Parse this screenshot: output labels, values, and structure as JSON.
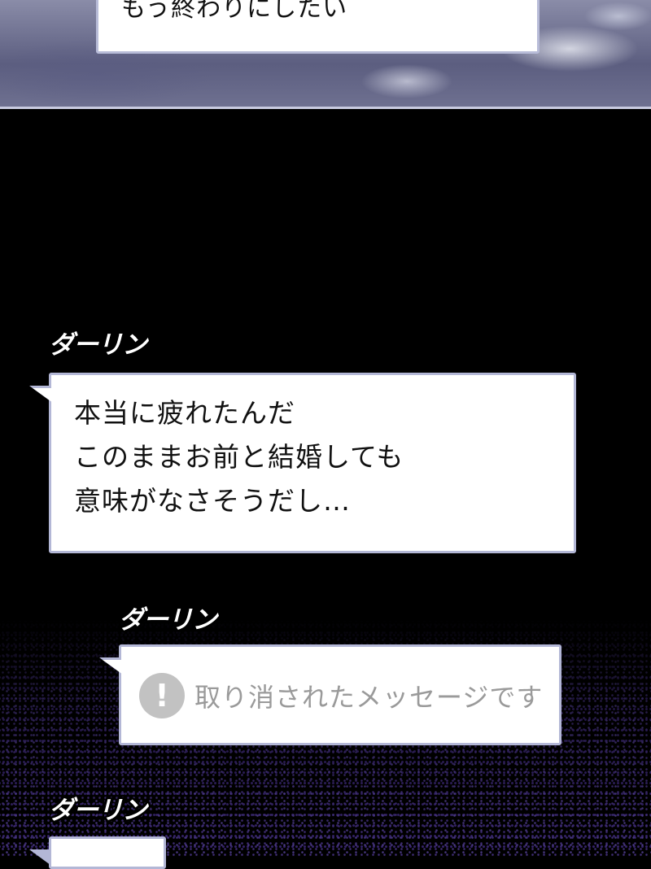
{
  "top_panel": {
    "message": "もう終わりにしたい"
  },
  "messages": [
    {
      "sender": "ダーリン",
      "lines": [
        "本当に疲れたんだ",
        "このままお前と結婚しても",
        "意味がなさそうだし…"
      ]
    },
    {
      "sender": "ダーリン",
      "deleted": true,
      "icon": "exclamation-icon",
      "text": "取り消されたメッセージです"
    },
    {
      "sender": "ダーリン"
    }
  ],
  "colors": {
    "background": "#000000",
    "bubble_border": "#b3b7d6",
    "deleted_text": "#9a9a9a",
    "dot_texture": "#46328a"
  }
}
